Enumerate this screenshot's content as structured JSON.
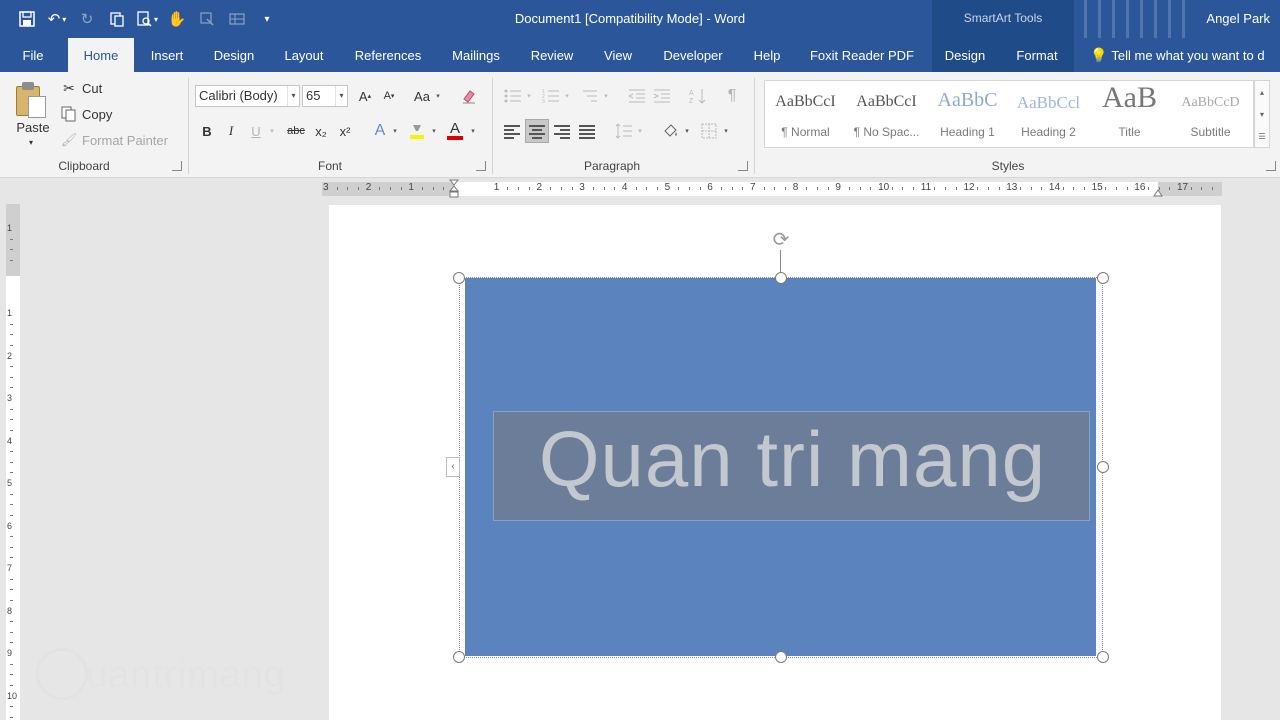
{
  "title_bar": {
    "document_title": "Document1 [Compatibility Mode]  -  Word",
    "contextual_group": "SmartArt Tools",
    "user_name": "Angel Park"
  },
  "tabs": {
    "file": "File",
    "home": "Home",
    "insert": "Insert",
    "design": "Design",
    "layout": "Layout",
    "references": "References",
    "mailings": "Mailings",
    "review": "Review",
    "view": "View",
    "developer": "Developer",
    "help": "Help",
    "foxit": "Foxit Reader PDF",
    "smartart_design": "Design",
    "smartart_format": "Format",
    "tell_me": "Tell me what you want to d"
  },
  "clipboard": {
    "paste": "Paste",
    "cut": "Cut",
    "copy": "Copy",
    "format_painter": "Format Painter",
    "label": "Clipboard"
  },
  "font": {
    "family": "Calibri (Body)",
    "size": "65",
    "label": "Font",
    "grow": "A",
    "shrink": "A",
    "case": "Aa",
    "bold": "B",
    "italic": "I",
    "underline": "U",
    "strike": "abc",
    "subscript": "x₂",
    "superscript": "x²",
    "effects": "A",
    "color": "A",
    "highlight_color": "#f5f500",
    "font_color": "#e00000"
  },
  "paragraph": {
    "label": "Paragraph",
    "pilcrow": "¶"
  },
  "styles": {
    "label": "Styles",
    "items": [
      {
        "preview": "AaBbCcI",
        "name": "¶ Normal"
      },
      {
        "preview": "AaBbCcI",
        "name": "¶ No Spac..."
      },
      {
        "preview": "AaBbC",
        "name": "Heading 1"
      },
      {
        "preview": "AaBbCcl",
        "name": "Heading 2"
      },
      {
        "preview": "AaB",
        "name": "Title"
      },
      {
        "preview": "AaBbCcD",
        "name": "Subtitle"
      }
    ]
  },
  "ruler": {
    "h_numbers": [
      "3",
      "2",
      "1",
      "1",
      "2",
      "3",
      "4",
      "5",
      "6",
      "7",
      "8",
      "9",
      "10",
      "11",
      "12",
      "13",
      "14",
      "15",
      "16",
      "17"
    ],
    "v_numbers": [
      "1",
      "1",
      "2",
      "3",
      "4",
      "5",
      "6",
      "7",
      "8",
      "9",
      "10"
    ]
  },
  "document": {
    "smartart_text": "Quan tri mang",
    "shape_color": "#5b84bf"
  },
  "watermark": {
    "text": "uantrimang"
  },
  "colors": {
    "accent": "#2b579a",
    "ribbon_bg": "#f3f3f3"
  }
}
